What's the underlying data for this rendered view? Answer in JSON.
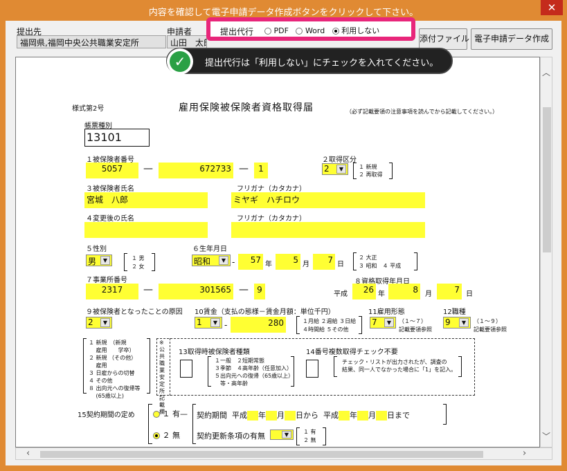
{
  "window": {
    "title": "内容を確認して電子申請データ作成ボタンをクリックして下さい。",
    "close": "✕"
  },
  "header": {
    "submit_to_label": "提出先",
    "submit_to_value": "福岡県,福岡中央公共職業安定所",
    "applicant_label": "申請者",
    "applicant_value": "山田　太郎",
    "proxy_label": "提出代行",
    "proxy_options": [
      "PDF",
      "Word",
      "利用しない"
    ],
    "proxy_selected": "利用しない",
    "attach_button": "添付ファイル",
    "create_button": "電子申請データ作成"
  },
  "tip": {
    "text": "提出代行は「利用しない」にチェックを入れてください。",
    "icon": "check-icon",
    "color": "#2aa045"
  },
  "form": {
    "form_no": "様式第2号",
    "title": "雇用保険被保険者資格取得届",
    "note": "（必ず記載要領の注意事項を読んでから記載してください。）",
    "ledger_label": "帳票種別",
    "ledger_value": "13101",
    "insured_no_label": "１被保険者番号",
    "insured_no": [
      "5057",
      "672733",
      "1"
    ],
    "acq_kind_label": "２取得区分",
    "acq_kind_value": "2",
    "acq_kind_opts": [
      "１ 新規",
      "２ 再取得"
    ],
    "name_label": "３被保険者氏名",
    "name_value": "宮城　八郎",
    "kana_label": "フリガナ（カタカナ）",
    "kana_value": "ミヤギ　ハチロウ",
    "changed_name_label": "４変更後の氏名",
    "changed_kana_label": "フリガナ（カタカナ）",
    "sex_label": "５性別",
    "sex_value": "男",
    "sex_opts": [
      "１ 男",
      "２ 女"
    ],
    "dob_label": "６生年月日",
    "era_value": "昭和",
    "dob_year": "57",
    "dob_month": "5",
    "dob_day": "7",
    "unit_year": "年",
    "unit_month": "月",
    "unit_day": "日",
    "era_opts": [
      "２ 大正",
      "３ 昭和　４ 平成"
    ],
    "office_no_label": "７事業所番号",
    "office_no": [
      "2317",
      "301565",
      "9"
    ],
    "acq_date_label": "８資格取得年月日",
    "acq_era": "平成",
    "acq_year": "26",
    "acq_month": "8",
    "acq_day": "7",
    "cause_label": "９被保険者となったことの原因",
    "cause_value": "2",
    "wage_label": "10賃金（支払の態様－賃金月額：単位千円）",
    "wage_type": "1",
    "wage_amount": "280",
    "wage_opts": [
      "１月給 ２週給 ３日給",
      "４時間給 ５その他"
    ],
    "emp_label": "11雇用形態",
    "emp_value": "7",
    "emp_opts": [
      "（１～７）",
      "記載要領参照"
    ],
    "job_label": "12職種",
    "job_value": "9",
    "job_opts": [
      "（１～９）",
      "記載要領参照"
    ],
    "cause_opts": [
      "１ 新規　（新規",
      "　 雇用　　学卒）",
      "２ 新規 （その他）",
      "　 雇用",
      "３ 日雇からの切替",
      "４ その他",
      "８ 出向元への復帰等",
      "　 (65歳以上)"
    ],
    "office_use": "※公共職業安定所記載欄",
    "item13_label": "13取得時被保険者種類",
    "item13_opts": [
      "１一般　２短期常態",
      "３季節　４高年齢（任意加入）",
      "５出向元への復帰（65歳以上）",
      "　等・高年齢"
    ],
    "item14_label": "14番号複数取得チェック不要",
    "item14_note": [
      "チェック・リストが出力されたが、調査の",
      "結果、同一人でなかった場合に「1」を記入。"
    ],
    "item15_label": "15契約期間の定め",
    "c_yes": "１ 有",
    "c_no": "２ 無",
    "c_selected": "２ 無",
    "c_period": "契約期間",
    "c_heisei": "平成",
    "c_year": "年",
    "c_month": "月",
    "c_from": "日から",
    "c_heisei2": "平成",
    "c_year2": "年",
    "c_month2": "月",
    "c_to": "日まで",
    "c_renew": "契約更新条項の有無",
    "c_renew_opts": [
      "１ 有",
      "２ 無"
    ]
  }
}
